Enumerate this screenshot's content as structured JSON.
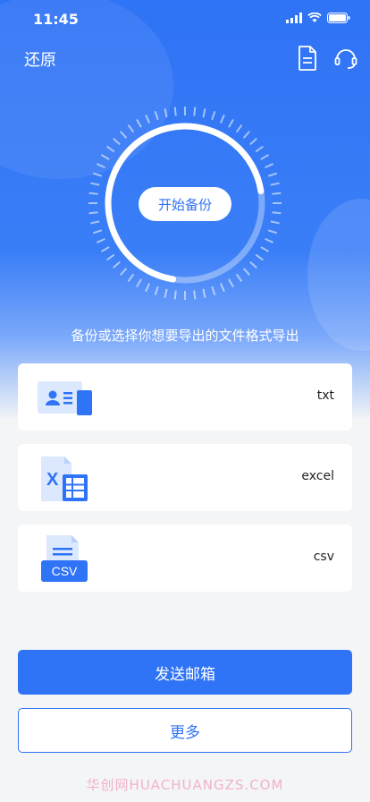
{
  "status_bar": {
    "time": "11:45"
  },
  "nav": {
    "title": "还原",
    "doc_icon": "document-icon",
    "support_icon": "headset-icon"
  },
  "backup": {
    "start_label": "开始备份",
    "hint": "备份或选择你想要导出的文件格式导出"
  },
  "formats": [
    {
      "label": "txt",
      "icon": "contact-card-icon"
    },
    {
      "label": "excel",
      "icon": "excel-file-icon"
    },
    {
      "label": "csv",
      "icon": "csv-file-icon",
      "badge": "CSV"
    }
  ],
  "actions": {
    "send_email": "发送邮箱",
    "more": "更多"
  },
  "watermark": "华创网HUACHUANGZS.COM",
  "colors": {
    "primary": "#2f73f6",
    "background": "#f4f5f7"
  }
}
